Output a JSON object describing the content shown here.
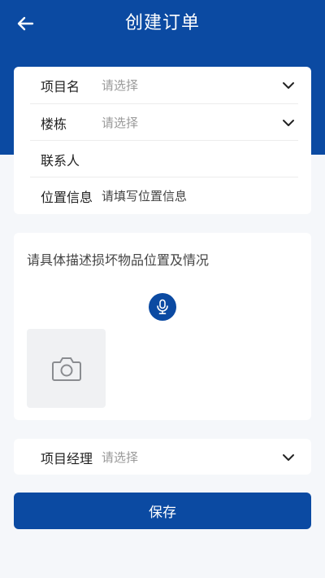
{
  "header": {
    "title": "创建订单",
    "back_icon": "arrow-left-icon",
    "background": "#0b4aa2"
  },
  "form": {
    "rows": [
      {
        "label": "项目名",
        "value": "请选择",
        "has_dropdown": true
      },
      {
        "label": "楼栋",
        "value": "请选择",
        "has_dropdown": true
      },
      {
        "label": "联系人",
        "value": "",
        "has_dropdown": false
      },
      {
        "label": "位置信息",
        "value": "请填写位置信息",
        "has_dropdown": false
      }
    ]
  },
  "description": {
    "placeholder": "请具体描述损坏物品位置及情况",
    "mic_icon": "microphone-icon",
    "photo_icon": "camera-icon"
  },
  "manager": {
    "label": "项目经理",
    "value": "请选择"
  },
  "save_label": "保存",
  "colors": {
    "primary": "#0b4aa2",
    "placeholder": "#9a9a9a"
  }
}
